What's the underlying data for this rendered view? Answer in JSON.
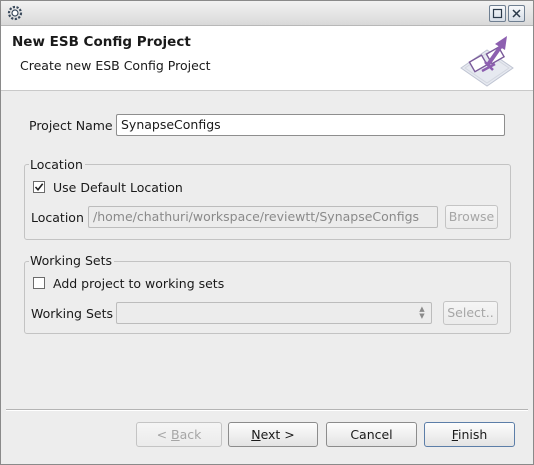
{
  "dialog": {
    "title_bar_buttons": {
      "maximize_icon": "maximize-icon",
      "close_icon": "close-icon"
    },
    "banner": {
      "title": "New ESB Config Project",
      "description": "Create new ESB Config Project",
      "wizard_image": "new-project-wizard-icon"
    },
    "project_name": {
      "label": "Project Name",
      "value": "SynapseConfigs"
    },
    "location_group": {
      "legend": "Location",
      "use_default_label": "Use Default Location",
      "use_default_checked": true,
      "location_label": "Location",
      "location_value": "/home/chathuri/workspace/reviewtt/SynapseConfigs",
      "browse_label": "Browse"
    },
    "working_sets_group": {
      "legend": "Working Sets",
      "add_label": "Add project to working sets",
      "add_checked": false,
      "working_sets_label": "Working Sets",
      "working_sets_value": "",
      "select_label": "Select.."
    },
    "buttons": {
      "back": {
        "prefix": "< ",
        "mnemonic": "B",
        "rest": "ack"
      },
      "next": {
        "mnemonic": "N",
        "rest": "ext >"
      },
      "cancel": "Cancel",
      "finish": {
        "mnemonic": "F",
        "rest": "inish"
      }
    }
  }
}
